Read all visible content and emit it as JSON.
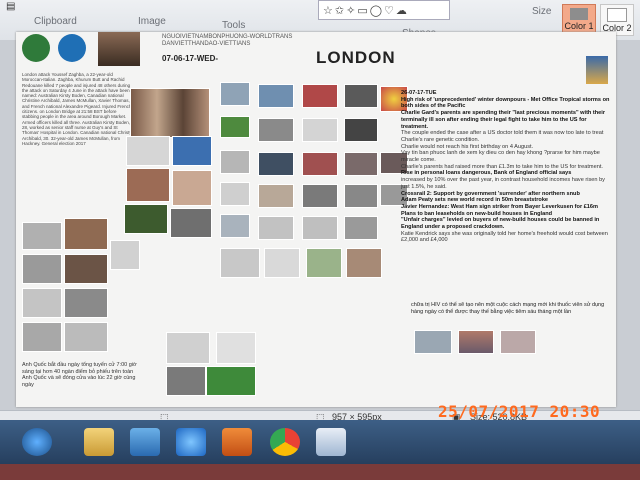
{
  "ribbon": {
    "clipboard_label": "Clipboard",
    "image_label": "Image",
    "tools_label": "Tools",
    "shapes_label": "Shapes",
    "size_label": "Size",
    "color1_label": "Color 1",
    "color2_label": "Color 2",
    "colors": {
      "color1": "#f3a98a",
      "color2": "#f7f7f7"
    }
  },
  "poster": {
    "header_lines": [
      "NGUOIVIETNAMBONPHUONG-WORLDTRANS",
      "DANVIETTHANDAO-VIETTIANS"
    ],
    "date": "07-06-17-WED-",
    "title": "LONDON",
    "left_text": "London attack Youssef Zaghba, a 22-year-old Moroccan-Italian. Zaghba, Khurum Butt and Rachid Redouane killed 7 people and injured 48 others during the attack on Saturday 4 June in the attack have been named: Australian Kirsty Boden, Canadian national Christine Archibald, James McMullan, Xavier Thomas, and French national Alexandre Pigeard. Injured French citizens. on London Bridge at 21:58 BST before stabbing people in the area around Borough Market. Armed officers killed all three. Australian Kirsty Boden, 28, worked as senior staff nurse at Guy's and St Thomas' Hospital in London. Canadian national Christy Archibald, 30. 32-year-old James McMullan, from Hackney. General election 2017",
    "right_date": "26-07-17-TUE",
    "right_text": [
      {
        "h": true,
        "t": "High risk of 'unprecedented' winter downpours - Met Office Tropical storms on both sides of the Pacific"
      },
      {
        "h": true,
        "t": "Charlie Gard's parents are spending their \"last precious moments\" with their terminally ill son after ending their legal fight to take him to the US for treatment."
      },
      {
        "h": false,
        "t": "The couple ended the case after a US doctor told them it was now too late to treat Charlie's rare genetic condition."
      },
      {
        "h": false,
        "t": "Charlie would not reach his first birthday on 4 August."
      },
      {
        "h": false,
        "t": "Vay tin ban phuoc lanh de xem ky dieu co den hay khong ?prarse for him maybe miracle come."
      },
      {
        "h": false,
        "t": "Charlie's parents had raised more than £1.3m to take him to the US for treatment."
      },
      {
        "h": true,
        "t": "Rise in personal loans dangerous, Bank of England official says"
      },
      {
        "h": false,
        "t": "increased by 10% over the past year, in contrast household incomes have risen by just 1.5%, he said."
      },
      {
        "h": true,
        "t": "Crossrail 2: Support by government 'surrender' after northern snub"
      },
      {
        "h": true,
        "t": "Adam Peaty sets new world record in 50m breaststroke"
      },
      {
        "h": true,
        "t": "Javier Hernandez: West Ham sign striker from Bayer Leverkusen for £16m"
      },
      {
        "h": true,
        "t": "Plans to ban leaseholds on new-build houses in England"
      },
      {
        "h": true,
        "t": "\"Unfair charges\" levied on buyers of new-build houses could be banned in England under a proposed crackdown."
      },
      {
        "h": false,
        "t": "Katie Kendrick says she was originally told her home's freehold would cost between £2,000 and £4,000"
      }
    ],
    "viet_right": "chữa trị HIV có thể sẽ tạo nên một cuộc cách mạng mới khi thuốc viên sử dụng hàng ngày có thể được thay thế bằng việc tiêm sáu tháng một lần",
    "viet_bottom": "Anh Quốc bắt đầu ngày tổng tuyển cử 7:00 giờ sáng tại hơn 40 ngàn điểm bỏ phiếu trên toàn Anh Quốc và sẽ đóng cửa vào lúc 22 giờ cùng ngày"
  },
  "status": {
    "dimensions": "957 × 595px",
    "size": "Size: 520.8KB"
  },
  "camera": {
    "timestamp": "25/07/2017 20:30"
  }
}
